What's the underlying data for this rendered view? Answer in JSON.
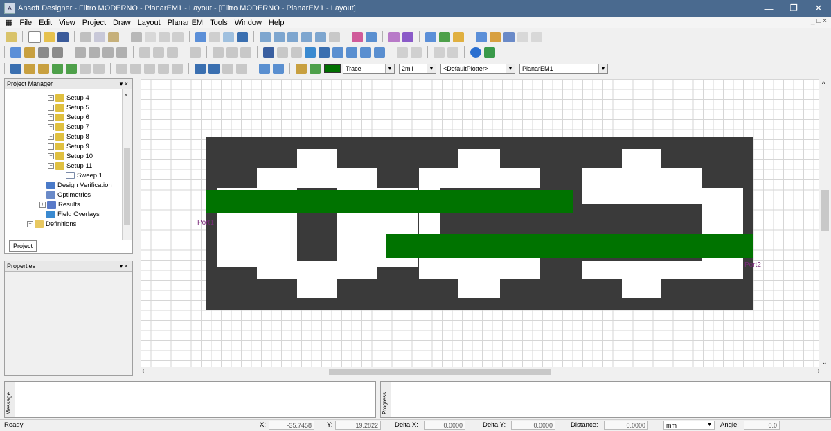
{
  "window": {
    "title": "Ansoft Designer - Filtro MODERNO - PlanarEM1 - Layout - [Filtro MODERNO - PlanarEM1 - Layout]"
  },
  "menu": [
    "File",
    "Edit",
    "View",
    "Project",
    "Draw",
    "Layout",
    "Planar EM",
    "Tools",
    "Window",
    "Help"
  ],
  "toolbar": {
    "layer_value": "Trace",
    "width_value": "2mil",
    "plotter_value": "<DefaultPlotter>",
    "design_value": "PlanarEM1"
  },
  "project_manager": {
    "title": "Project Manager",
    "items": [
      {
        "label": "Setup 4"
      },
      {
        "label": "Setup 5"
      },
      {
        "label": "Setup 6"
      },
      {
        "label": "Setup 7"
      },
      {
        "label": "Setup 8"
      },
      {
        "label": "Setup 9"
      },
      {
        "label": "Setup 10"
      },
      {
        "label": "Setup 11"
      },
      {
        "label": "Sweep 1"
      },
      {
        "label": "Design Verification"
      },
      {
        "label": "Optimetrics"
      },
      {
        "label": "Results"
      },
      {
        "label": "Field Overlays"
      },
      {
        "label": "Definitions"
      }
    ],
    "tab": "Project"
  },
  "properties": {
    "title": "Properties"
  },
  "layout": {
    "port1_label": "Port1",
    "port2_label": "Port2",
    "ground_color": "#3a3a3a",
    "trace_color": "#007300"
  },
  "message_label": "Message",
  "progress_label": "Progress",
  "status": {
    "ready": "Ready",
    "x_label": "X:",
    "x_value": "-35.7458",
    "y_label": "Y:",
    "y_value": "19.2822",
    "dx_label": "Delta X:",
    "dx_value": "0.0000",
    "dy_label": "Delta Y:",
    "dy_value": "0.0000",
    "dist_label": "Distance:",
    "dist_value": "0.0000",
    "units": "mm",
    "angle_label": "Angle:",
    "angle_value": "0.0"
  }
}
